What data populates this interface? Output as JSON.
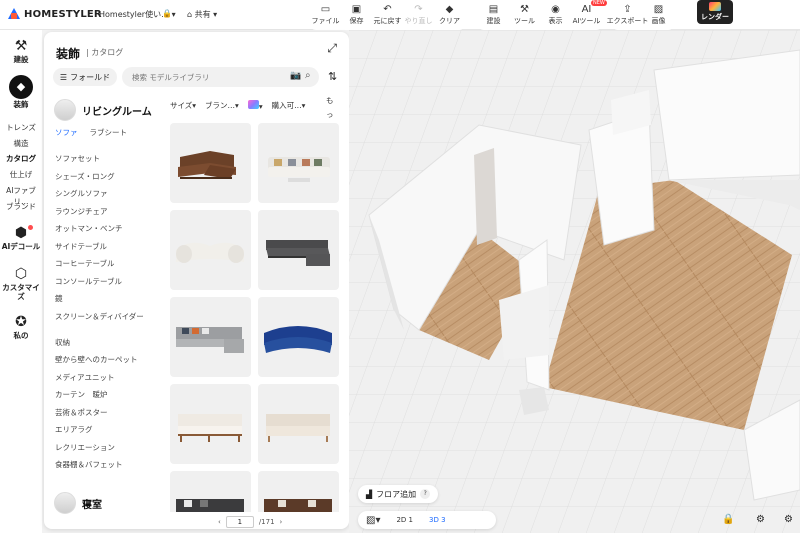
{
  "app": {
    "brand": "HOMESTYLER",
    "design_name": "Homestyler使い…",
    "share_label": "共有"
  },
  "toolbar": {
    "group1": [
      {
        "icon": "file-icon",
        "glyph": "▭",
        "label": "ファイル"
      },
      {
        "icon": "save-icon",
        "glyph": "▣",
        "label": "保存"
      },
      {
        "icon": "undo-icon",
        "glyph": "↶",
        "label": "元に戻す"
      },
      {
        "icon": "redo-icon",
        "glyph": "↷",
        "label": "やり直し"
      },
      {
        "icon": "clear-icon",
        "glyph": "◆",
        "label": "クリア"
      }
    ],
    "group2": [
      {
        "icon": "build-icon",
        "glyph": "▤",
        "label": "建設"
      },
      {
        "icon": "tools-icon",
        "glyph": "⚒",
        "label": "ツール"
      },
      {
        "icon": "view-icon",
        "glyph": "◉",
        "label": "表示"
      },
      {
        "icon": "ai-tools-icon",
        "glyph": "AI",
        "label": "AIツール"
      }
    ],
    "group3": [
      {
        "icon": "export-icon",
        "glyph": "⇪",
        "label": "エクスポート"
      },
      {
        "icon": "image-icon",
        "glyph": "▨",
        "label": "画像"
      }
    ],
    "render_label": "レンダー",
    "new_badge": "NEW"
  },
  "rail": {
    "build": "建設",
    "decor": "装飾",
    "subs": [
      "トレンズ",
      "構造",
      "カタログ",
      "仕上げ",
      "AIファブリ…",
      "ブランド"
    ],
    "ai_decor": "AIデコール",
    "customize": "カスタマイズ",
    "mine": "私の"
  },
  "panel": {
    "title": "装飾",
    "subtitle": "カタログ",
    "folder_label": "フォールド",
    "search_placeholder": "検索 モデルライブラリ",
    "category_title": "リビングルーム",
    "subcategories_row1": [
      "ソファ",
      "ラブシート"
    ],
    "subcategories": [
      "ソファセット",
      "シェーズ・ロング",
      "シングルソファ",
      "ラウンジチェア",
      "オットマン・ベンチ",
      "サイドテーブル",
      "コーヒーテーブル",
      "コンソールテーブル",
      "鏡",
      "スクリーン＆ディバイダー",
      "収納",
      "壁から壁へのカーペット",
      "メディアユニット",
      "カーテン　暖炉",
      "芸術＆ポスター",
      "エリアラグ",
      "レクリエーション",
      "食器棚＆バフェット"
    ],
    "next_category": "寝室",
    "filters": [
      "サイズ",
      "ブラン…",
      "購入可…"
    ],
    "more": "もっと",
    "page_current": "1",
    "page_total": "/171"
  },
  "viewport": {
    "floor_add": "フロア追加",
    "help": "?",
    "view_2d": "2D 1",
    "view_3d": "3D 3"
  }
}
